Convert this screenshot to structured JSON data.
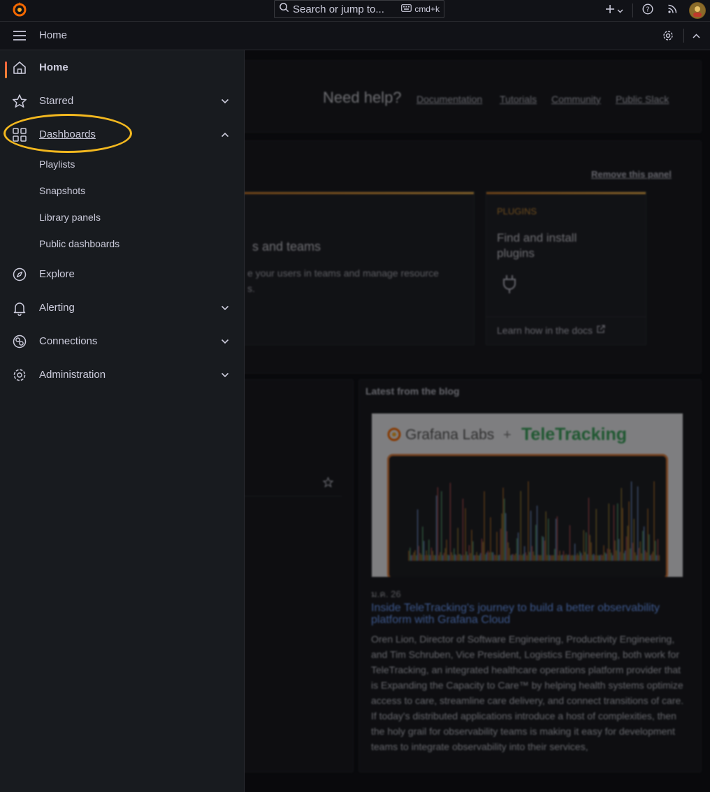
{
  "topbar": {
    "search_placeholder": "Search or jump to...",
    "shortcut": "cmd+k"
  },
  "breadcrumb": {
    "current": "Home"
  },
  "sidebar": {
    "items": [
      {
        "label": "Home"
      },
      {
        "label": "Starred"
      },
      {
        "label": "Dashboards"
      },
      {
        "label": "Explore"
      },
      {
        "label": "Alerting"
      },
      {
        "label": "Connections"
      },
      {
        "label": "Administration"
      }
    ],
    "dashboards_children": [
      "Playlists",
      "Snapshots",
      "Library panels",
      "Public dashboards"
    ]
  },
  "help": {
    "title": "Need help?",
    "links": [
      "Documentation",
      "Tutorials",
      "Community",
      "Public Slack"
    ]
  },
  "getting_started": {
    "remove_label": "Remove this panel",
    "users_card_title_fragment": "s and teams",
    "users_card_desc_fragment": "e your users in teams and manage resource",
    "users_card_desc_fragment2": "s.",
    "plugins_card": {
      "eyebrow": "PLUGINS",
      "title": "Find and install plugins",
      "footer": "Learn how in the docs"
    }
  },
  "blog": {
    "section_title": "Latest from the blog",
    "image_brand_left": "Grafana Labs",
    "image_brand_plus": "+",
    "image_brand_right": "TeleTracking",
    "date": "ม.ค. 26",
    "title": "Inside TeleTracking's journey to build a better observability platform with Grafana Cloud",
    "body": "Oren Lion, Director of Software Engineering, Productivity Engineering, and Tim Schruben, Vice President, Logistics Engineering, both work for TeleTracking, an integrated healthcare operations platform provider that is Expanding the Capacity to Care™ by helping health systems optimize access to care, streamline care delivery, and connect transitions of care. If today's distributed applications introduce a host of complexities, then the holy grail for observability teams is making it easy for development teams to integrate observability into their services,"
  },
  "colors": {
    "background": "#111217",
    "sidebar": "#181b1f",
    "accent_orange": "#ff8833",
    "highlight_ring": "#f3b81f",
    "link_blue": "#6e9fff"
  }
}
